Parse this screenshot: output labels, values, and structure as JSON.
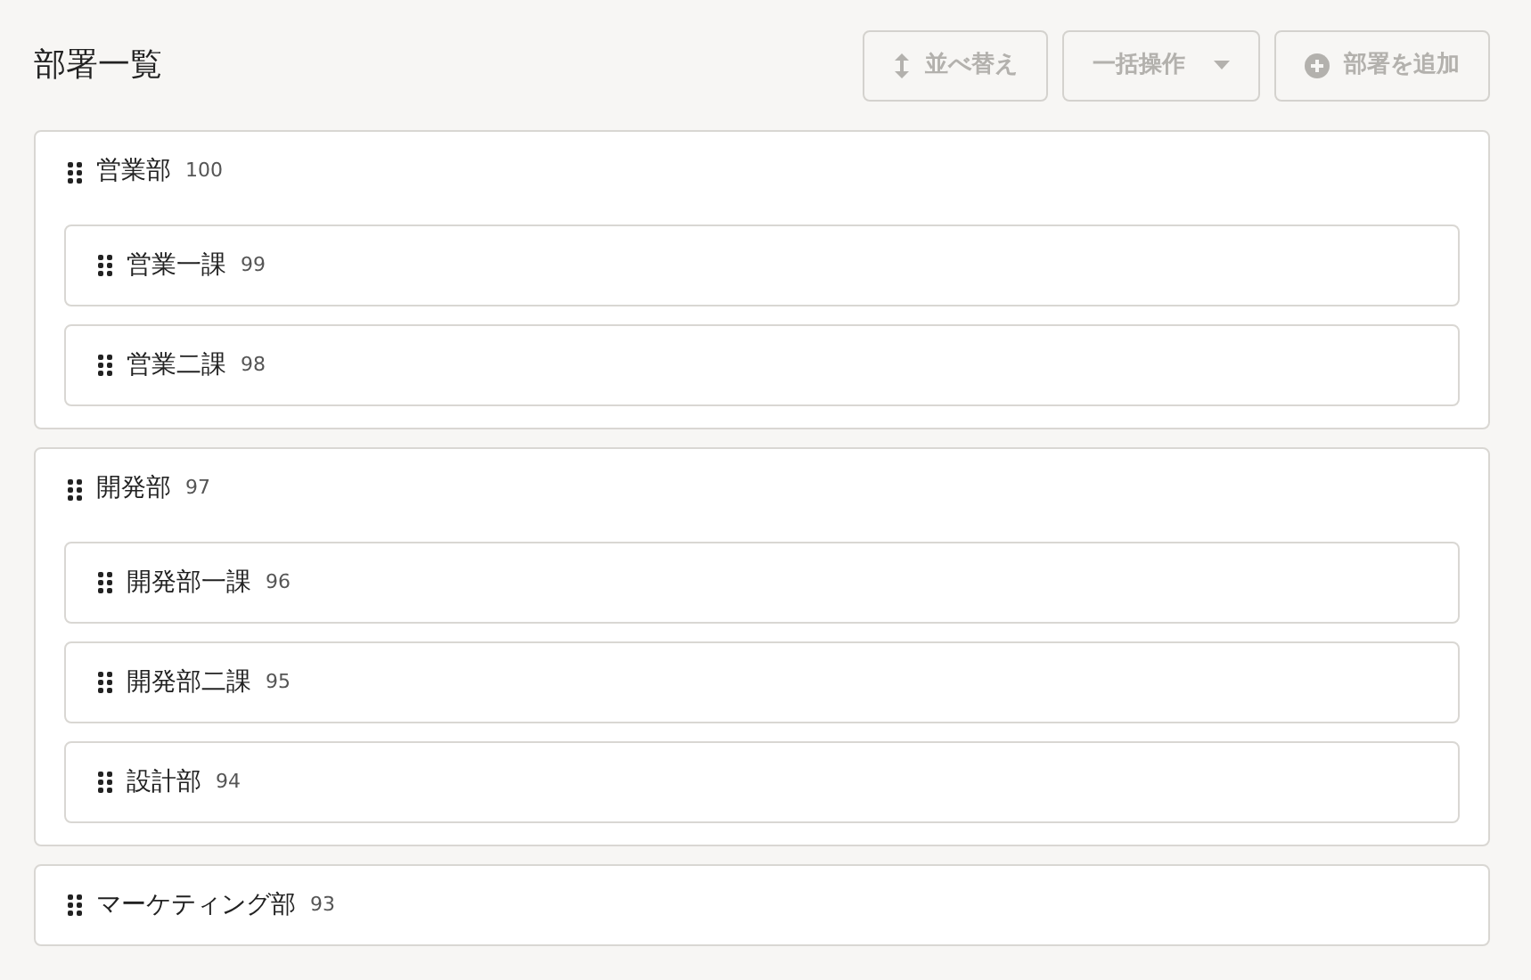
{
  "title": "部署一覧",
  "toolbar": [
    {
      "kind": "sort",
      "label": "並べ替え",
      "disabled": true
    },
    {
      "kind": "bulk",
      "label": "一括操作",
      "disabled": true
    },
    {
      "kind": "add",
      "label": "部署を追加",
      "disabled": true
    }
  ],
  "departments": [
    {
      "name": "営業部",
      "count": "100",
      "children": [
        {
          "name": "営業一課",
          "count": "99"
        },
        {
          "name": "営業二課",
          "count": "98"
        }
      ]
    },
    {
      "name": "開発部",
      "count": "97",
      "children": [
        {
          "name": "開発部一課",
          "count": "96"
        },
        {
          "name": "開発部二課",
          "count": "95"
        },
        {
          "name": "設計部",
          "count": "94"
        }
      ]
    },
    {
      "name": "マーケティング部",
      "count": "93"
    }
  ]
}
